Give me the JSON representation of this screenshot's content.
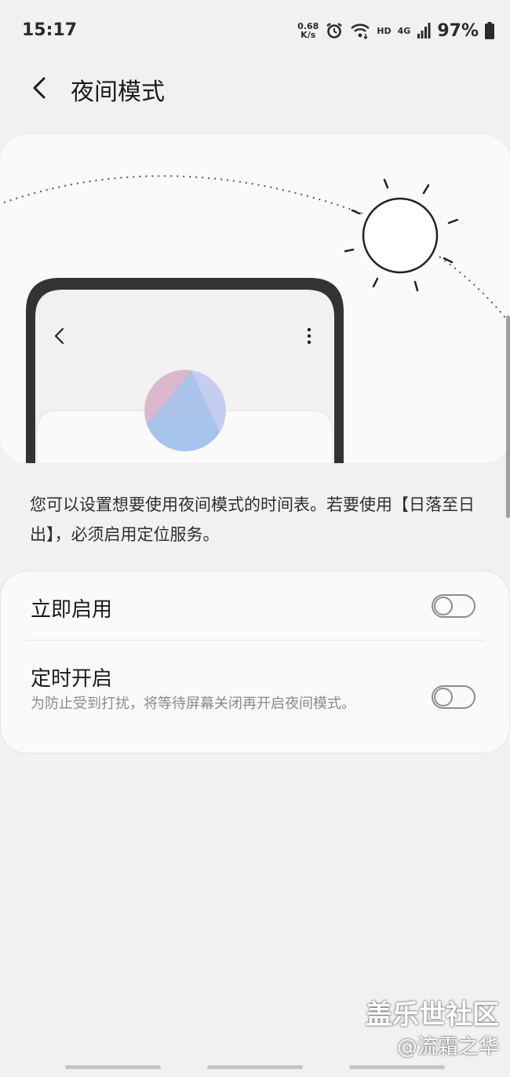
{
  "status_bar": {
    "time": "15:17",
    "speed_value": "0.68",
    "speed_unit": "K/s",
    "hd": "HD",
    "network": "4G",
    "battery": "97%"
  },
  "header": {
    "title": "夜间模式"
  },
  "illustration": {
    "icons": [
      "sun-icon",
      "phone-mockup",
      "back-icon",
      "more-icon"
    ],
    "colors": {
      "pie_pink": "#dcb5cd",
      "pie_blue": "#a4c2ea",
      "pie_lilac": "#c5cdf0"
    }
  },
  "description": "您可以设置想要使用夜间模式的时间表。若要使用【日落至日出】，必须启用定位服务。",
  "settings": {
    "enable_now": {
      "label": "立即启用",
      "enabled": false
    },
    "scheduled": {
      "label": "定时开启",
      "subtitle": "为防止受到打扰，将等待屏幕关闭再开启夜间模式。",
      "enabled": false
    }
  },
  "watermark": {
    "line1": "盖乐世社区",
    "line2": "@流霜之华"
  }
}
